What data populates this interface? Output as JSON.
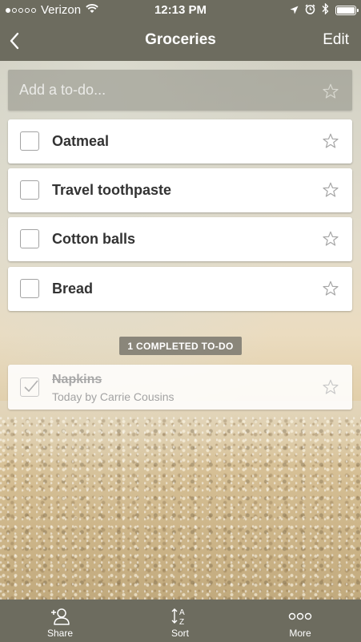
{
  "status_bar": {
    "carrier": "Verizon",
    "time": "12:13 PM"
  },
  "nav": {
    "title": "Groceries",
    "edit_label": "Edit"
  },
  "add_todo": {
    "placeholder": "Add a to-do..."
  },
  "todos": [
    {
      "title": "Oatmeal"
    },
    {
      "title": "Travel toothpaste"
    },
    {
      "title": "Cotton balls"
    },
    {
      "title": "Bread"
    }
  ],
  "completed_badge": "1 COMPLETED TO-DO",
  "completed": [
    {
      "title": "Napkins",
      "meta": "Today by Carrie Cousins"
    }
  ],
  "tabs": [
    {
      "label": "Share",
      "icon": "share-user-icon"
    },
    {
      "label": "Sort",
      "icon": "sort-az-icon"
    },
    {
      "label": "More",
      "icon": "more-dots-icon"
    }
  ],
  "colors": {
    "bar_background": "#6d6c5f",
    "badge_background": "#8a867a"
  }
}
